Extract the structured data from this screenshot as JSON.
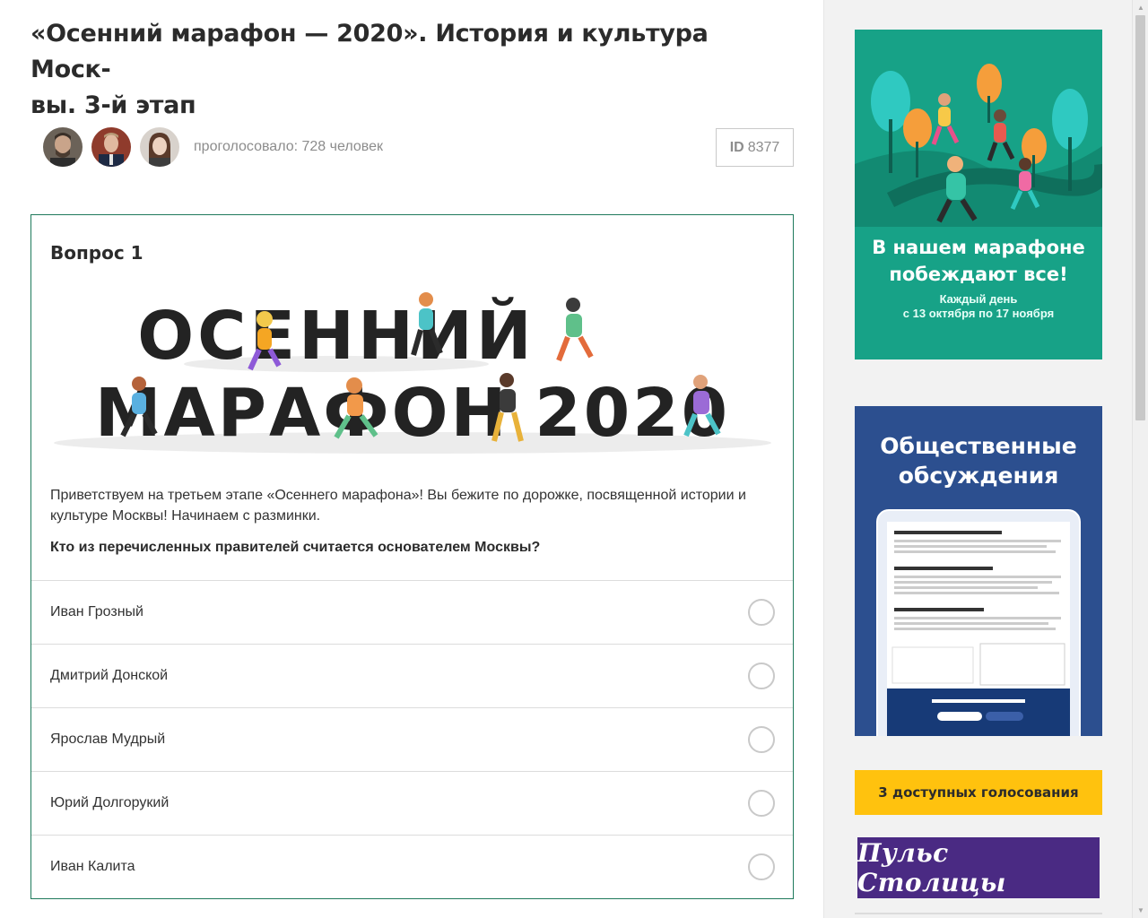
{
  "page": {
    "title": "«Осенний марафон — 2020». История и культура Моск-вы. 3-й этап",
    "title_line1": "«Осенний марафон — 2020». История и культура Моск-",
    "title_line2": "вы. 3-й этап"
  },
  "meta": {
    "voted_text": "проголосовало: 728 человек",
    "id_label": "ID",
    "id_value": "8377"
  },
  "question": {
    "label": "Вопрос 1",
    "banner_word1": "ОСЕННИЙ",
    "banner_word2": "МАРАФОН 2020",
    "intro": "Приветствуем на третьем этапе «Осеннего марафона»! Вы бежите по дорожке, посвященной истории и культуре Москвы! Начинаем с разминки.",
    "prompt": "Кто из перечисленных правителей считается основателем Москвы?",
    "options": [
      {
        "label": "Иван Грозный"
      },
      {
        "label": "Дмитрий Донской"
      },
      {
        "label": "Ярослав Мудрый"
      },
      {
        "label": "Юрий Долгорукий"
      },
      {
        "label": "Иван Калита"
      }
    ]
  },
  "sidebar": {
    "ad_marathon": {
      "headline": "В нашем марафоне побеждают все!",
      "headline_line1": "В нашем марафоне",
      "headline_line2": "побеждают все!",
      "sub_line1": "Каждый день",
      "sub_line2": "с 13 октября по 17 ноября"
    },
    "ad_discussions": {
      "headline_line1": "Общественные",
      "headline_line2": "обсуждения"
    },
    "votes_button": "3 доступных голосования",
    "pulse_logo": "Пульс Столицы"
  },
  "colors": {
    "accent_green": "#1f7a5c",
    "ad_green": "#17a287",
    "ad_blue": "#2c4f8f",
    "button_yellow": "#ffc20e",
    "pulse_purple": "#4a2a83"
  },
  "icons": [
    "avatar",
    "radio-icon",
    "scroll-up-icon",
    "scroll-down-icon"
  ]
}
